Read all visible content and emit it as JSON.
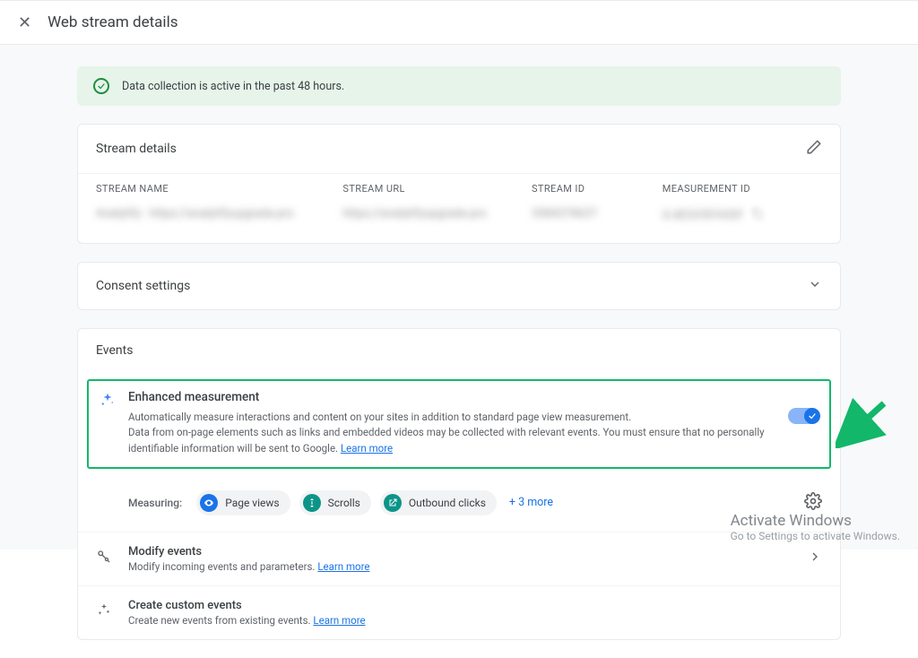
{
  "header": {
    "title": "Web stream details"
  },
  "banner": {
    "message": "Data collection is active in the past 48 hours."
  },
  "stream": {
    "card_title": "Stream details",
    "cols": {
      "name_h": "STREAM NAME",
      "url_h": "STREAM URL",
      "id_h": "STREAM ID",
      "mid_h": "MEASUREMENT ID"
    }
  },
  "consent": {
    "title": "Consent settings"
  },
  "events": {
    "title": "Events",
    "enhanced": {
      "title": "Enhanced measurement",
      "line1": "Automatically measure interactions and content on your sites in addition to standard page view measurement.",
      "line2": "Data from on-page elements such as links and embedded videos may be collected with relevant events. You must ensure that no personally identifiable information will be sent to Google.",
      "learn": "Learn more"
    },
    "measuring": {
      "label": "Measuring:",
      "pills": {
        "pv": "Page views",
        "sc": "Scrolls",
        "ob": "Outbound clicks"
      },
      "more": "+ 3 more"
    },
    "modify": {
      "title": "Modify events",
      "sub": "Modify incoming events and parameters.",
      "learn": "Learn more"
    },
    "custom": {
      "title": "Create custom events",
      "sub": "Create new events from existing events.",
      "learn": "Learn more"
    }
  },
  "watermark": {
    "l1": "Activate Windows",
    "l2": "Go to Settings to activate Windows."
  }
}
